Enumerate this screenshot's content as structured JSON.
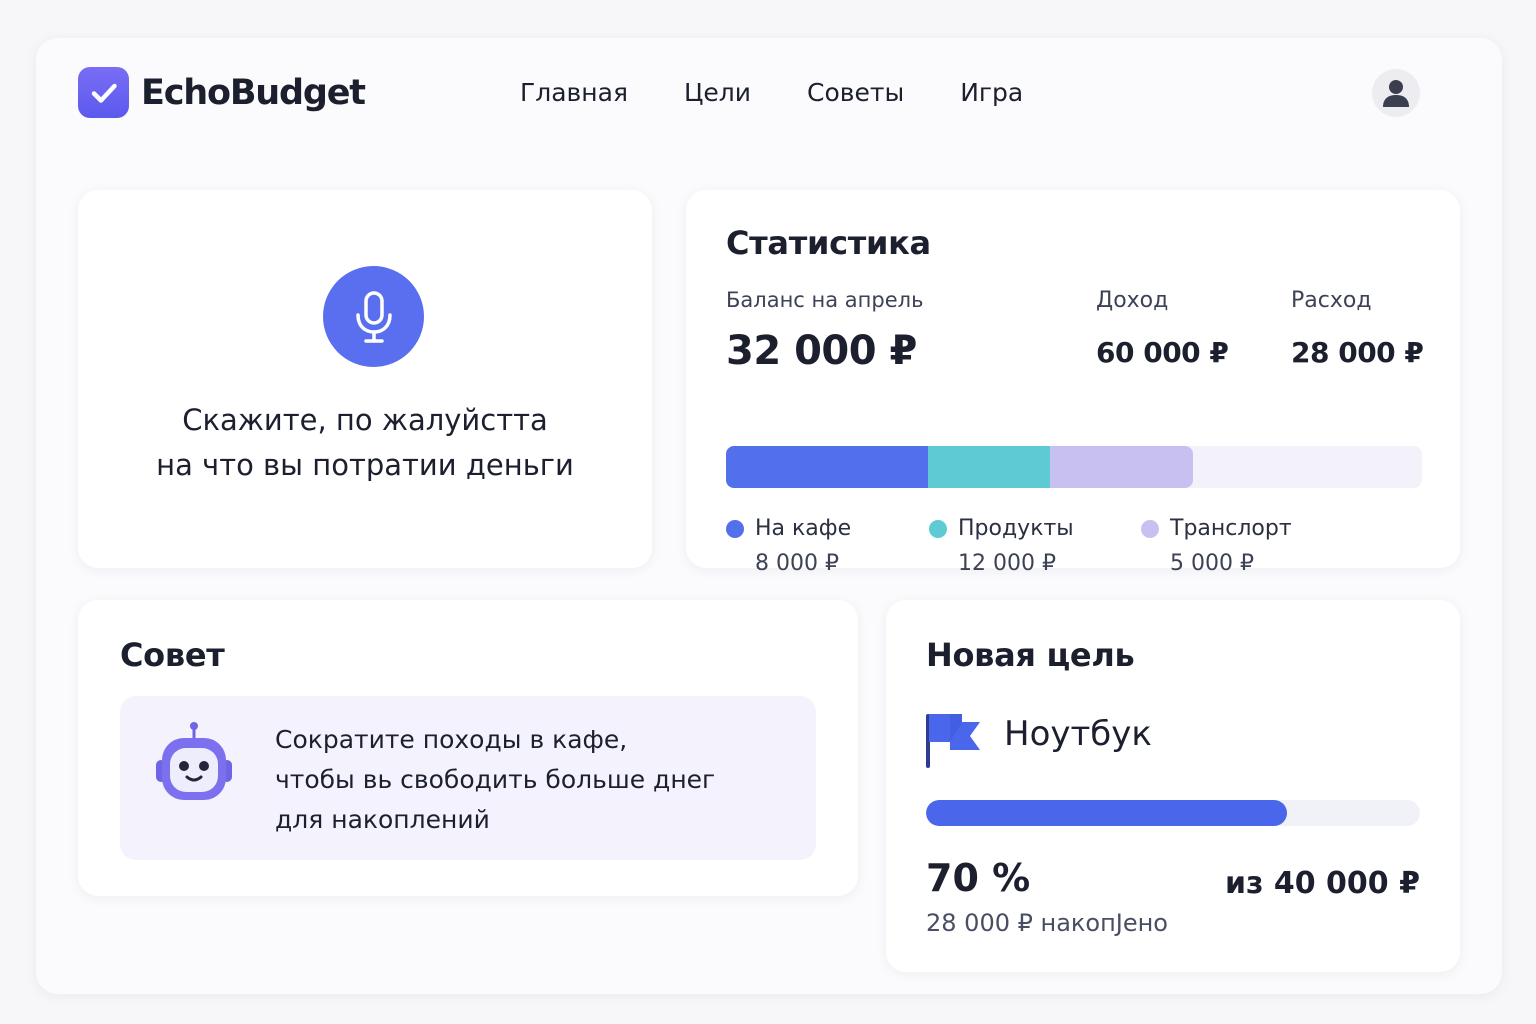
{
  "app": {
    "logo_text": "EchoBudget",
    "logo_icon": "checkmark-icon",
    "accent_color": "#5b59ee"
  },
  "nav": {
    "items": [
      {
        "label": "Главная"
      },
      {
        "label": "Цели"
      },
      {
        "label": "Советы"
      },
      {
        "label": "Игра"
      }
    ]
  },
  "user": {
    "avatar_icon": "user-icon"
  },
  "voice": {
    "icon": "microphone-icon",
    "line1": "Скажите, по жалуйстта",
    "line2": "на что вы потратии деньги"
  },
  "stats": {
    "title": "Статистика",
    "balance_label": "Баланс на апрель",
    "balance_value": "32 000 ₽",
    "income_label": "Доход",
    "income_value": "60 000 ₽",
    "expense_label": "Расход",
    "expense_value": "28 000 ₽",
    "categories": [
      {
        "name": "На кафе",
        "amount": "8 000 ₽",
        "color": "#5270ec",
        "share": 0.29
      },
      {
        "name": "Продукты",
        "amount": "12 000 ₽",
        "color": "#5ecbd4",
        "share": 0.175
      },
      {
        "name": "Транслорт",
        "amount": "5 000 ₽",
        "color": "#c9c0f2",
        "share": 0.205
      }
    ]
  },
  "tip": {
    "title": "Совет",
    "icon": "robot-icon",
    "line1": "Сократите походы в кафе,",
    "line2": "чтобы вь свободить больше днег",
    "line3": "для накоплений"
  },
  "goal": {
    "title": "Новая цель",
    "icon": "flag-icon",
    "name": "Ноутбук",
    "progress": 0.73,
    "percent_text": "70 %",
    "saved_text": "28 000 ₽  накопJено",
    "total_text": "из 40 000 ₽"
  }
}
